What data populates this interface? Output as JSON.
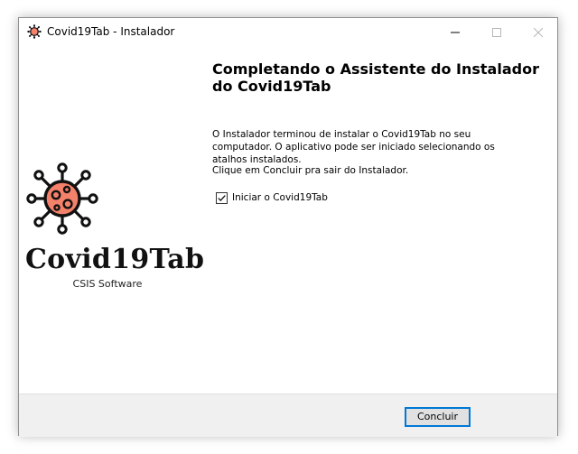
{
  "window": {
    "title": "Covid19Tab - Instalador",
    "minimize_glyph": "—",
    "maximize_glyph": "☐",
    "close_glyph": "✕"
  },
  "logo": {
    "icon": "virus-icon",
    "title": "Covid19Tab",
    "subtitle": "CSIS Software",
    "virus_color": "#f4816a",
    "outline_color": "#111111"
  },
  "page": {
    "heading": "Completando o Assistente do Instalador do Covid19Tab",
    "paragraph_1": "O Instalador terminou de instalar o Covid19Tab no seu computador. O aplicativo pode ser iniciado selecionando os atalhos instalados.",
    "paragraph_2": "Clique em Concluir pra sair do Instalador."
  },
  "options": {
    "launch_label": "Iniciar o Covid19Tab",
    "launch_checked": true
  },
  "footer": {
    "finish_label": "Concluir",
    "accent_color": "#0078d7"
  }
}
